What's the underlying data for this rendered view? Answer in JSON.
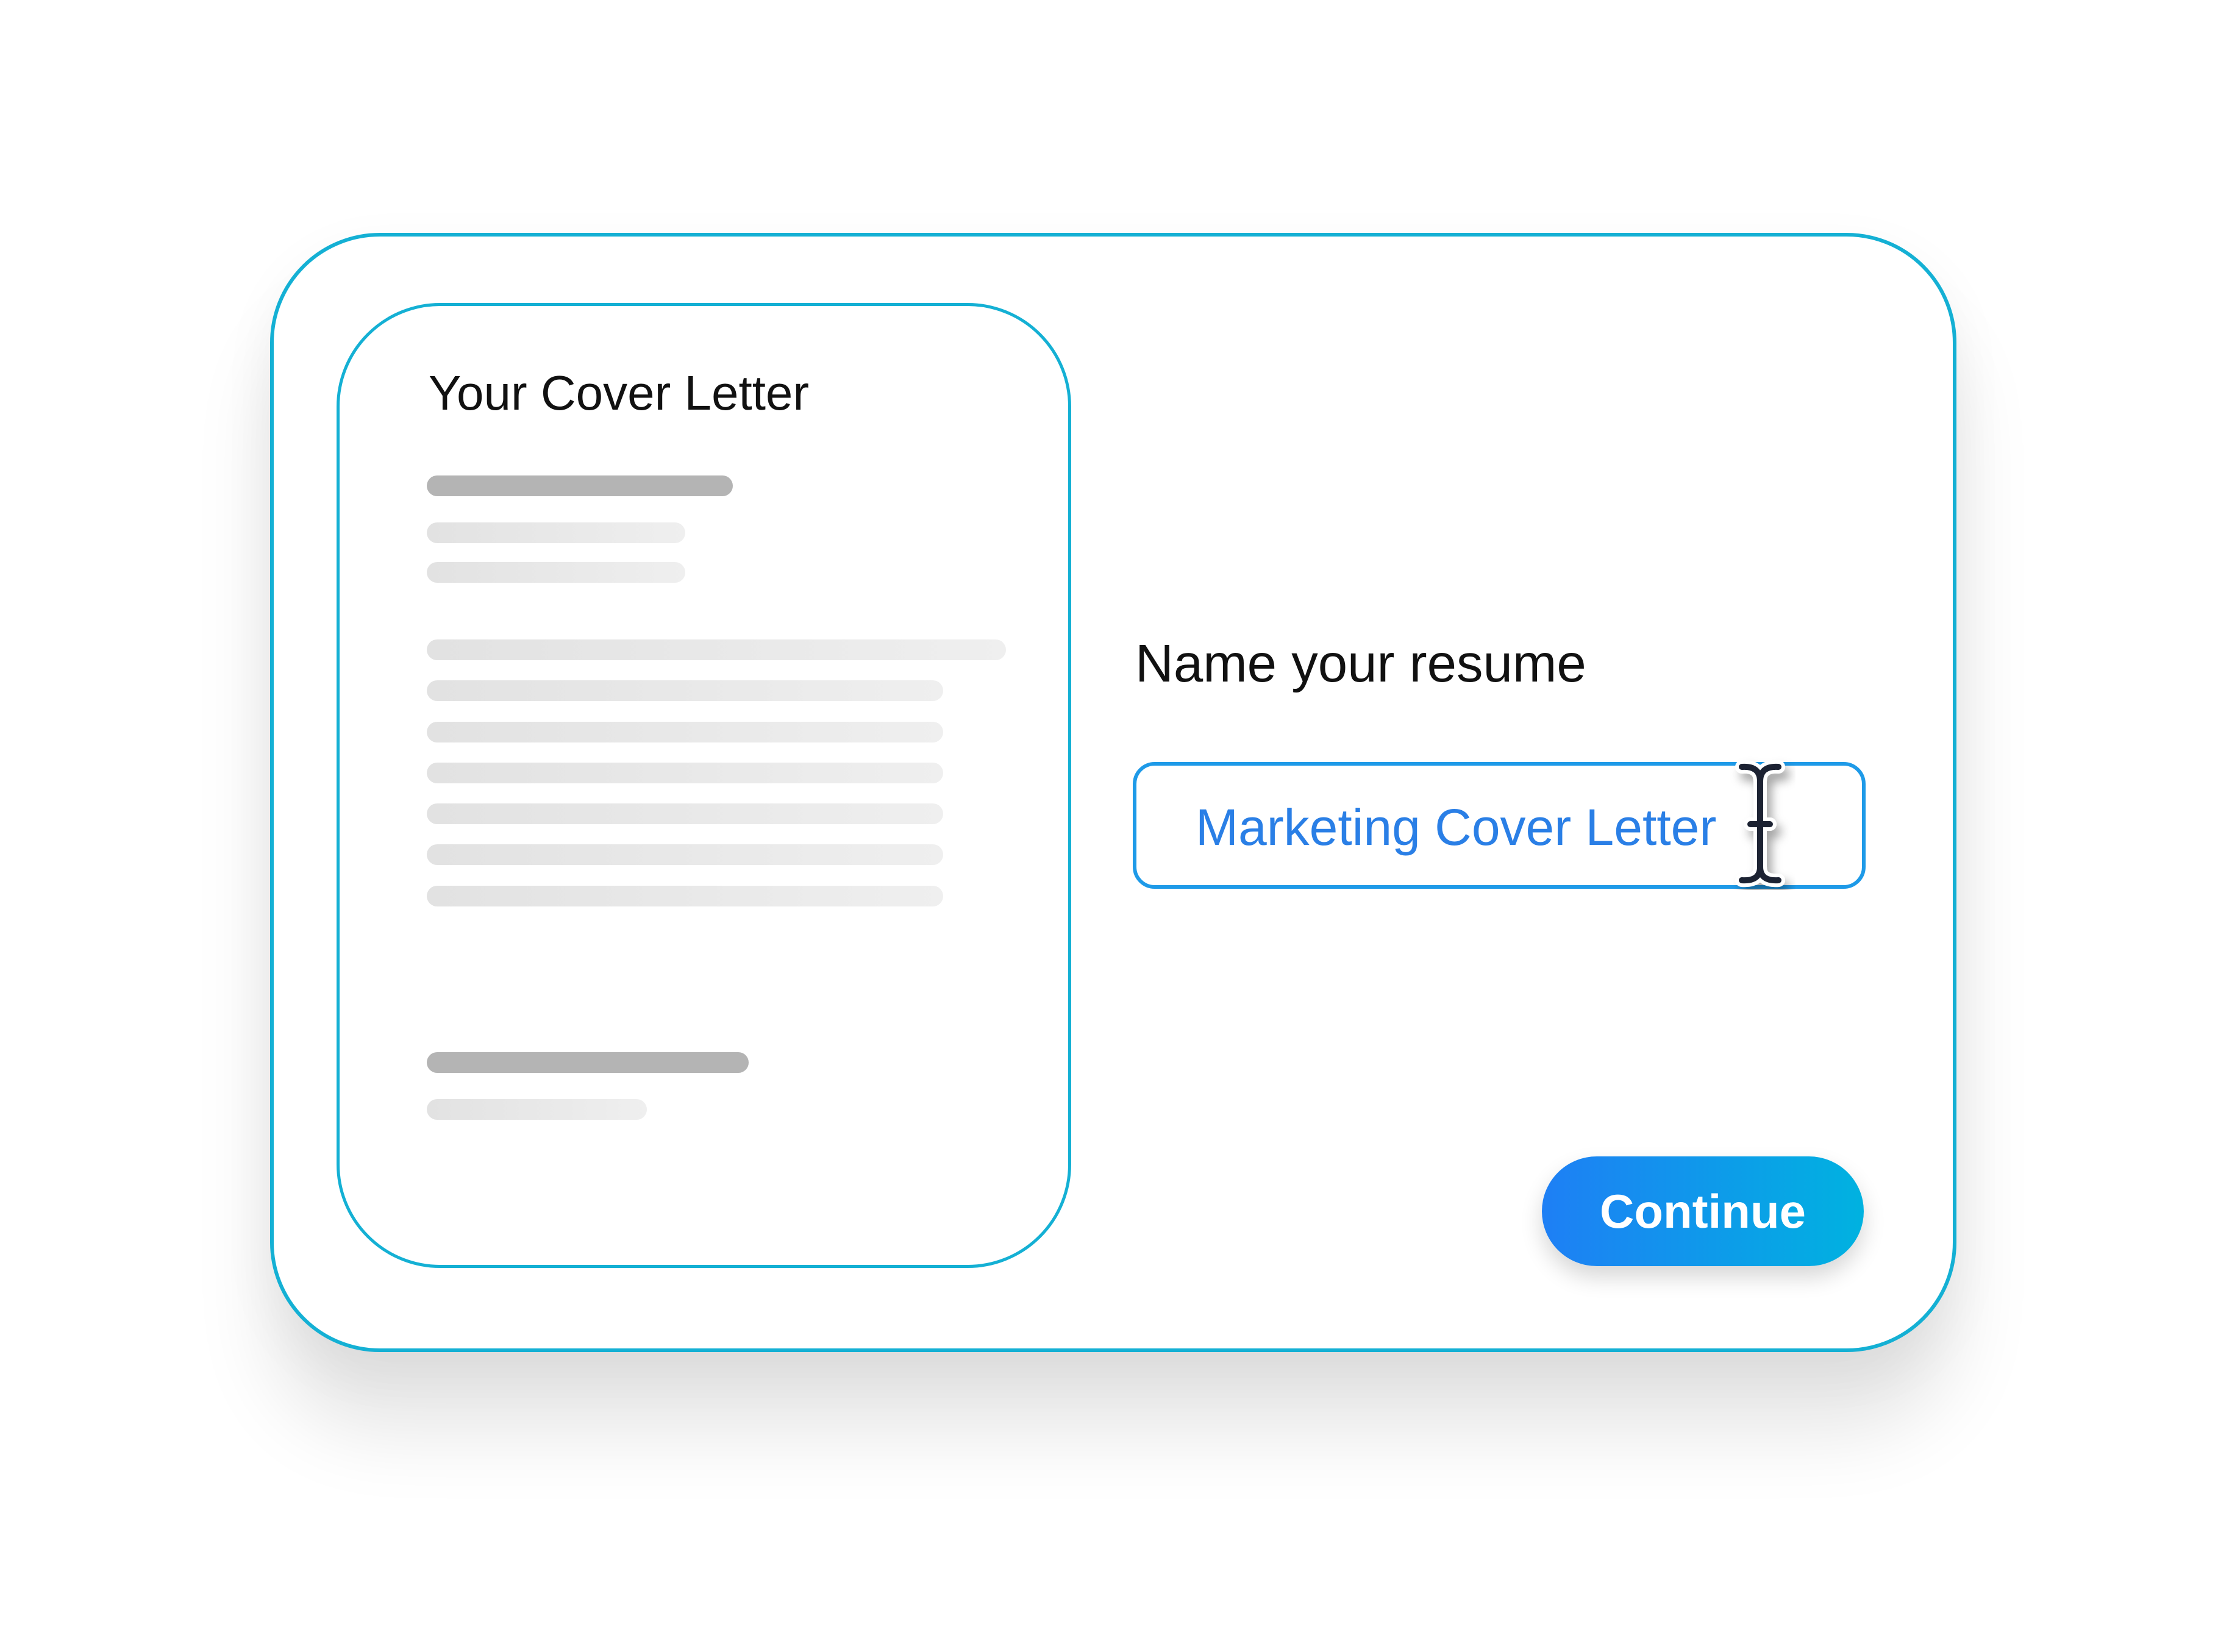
{
  "preview": {
    "title": "Your Cover Letter"
  },
  "form": {
    "label": "Name your resume",
    "input_value": "Marketing Cover Letter",
    "continue_label": "Continue"
  },
  "icons": {
    "cursor": "text-cursor-icon"
  },
  "colors": {
    "accent_border": "#14b0d4",
    "input_text": "#2a7fe6",
    "button_gradient_start": "#1e7ff5",
    "button_gradient_end": "#00b2e0"
  }
}
